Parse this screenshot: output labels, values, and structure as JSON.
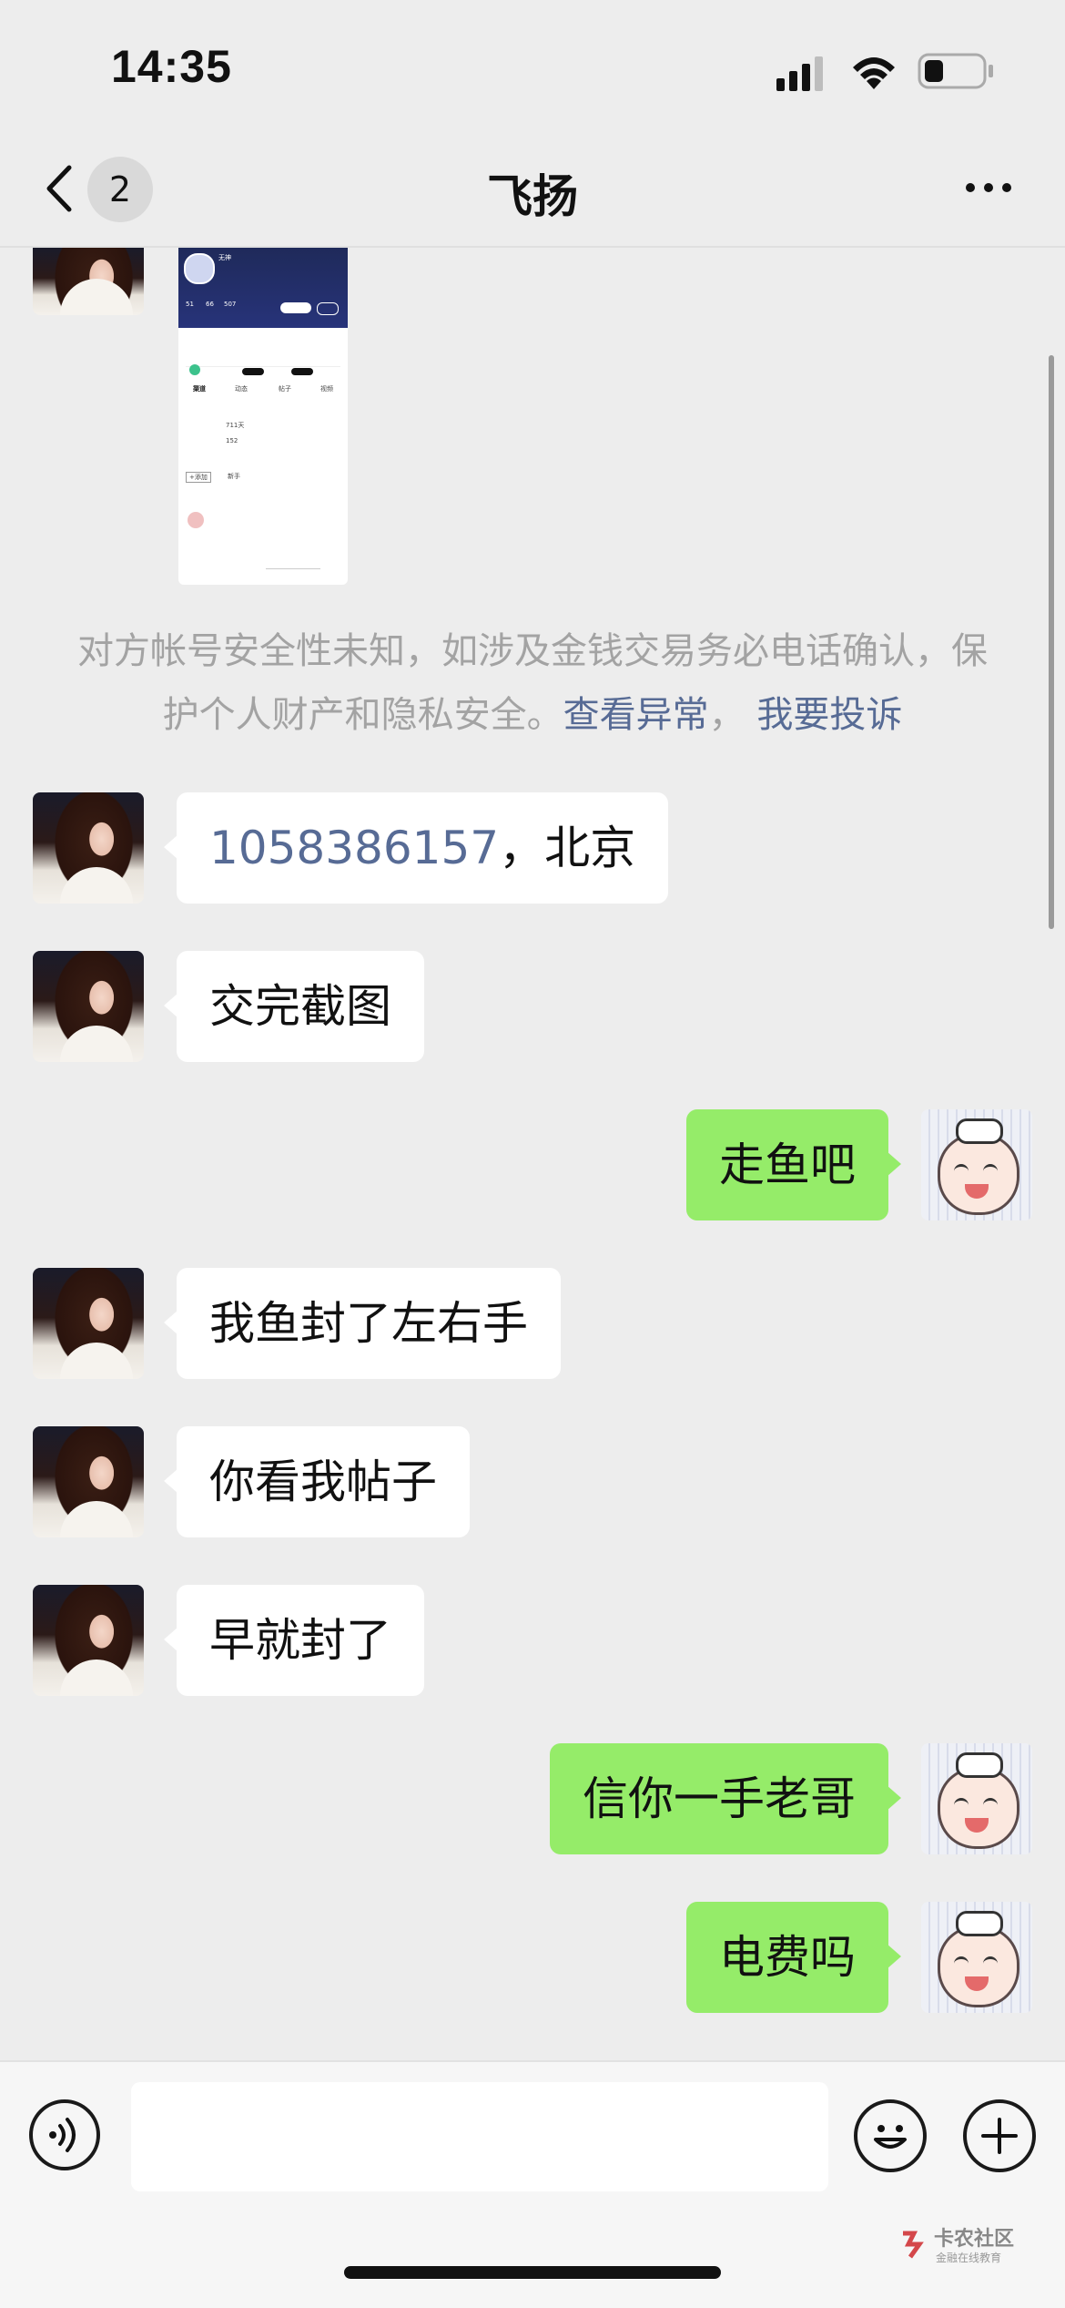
{
  "status_bar": {
    "time": "14:35"
  },
  "nav": {
    "badge": "2",
    "title": "飞扬"
  },
  "shared_image": {
    "username": "无神",
    "stats": [
      "51",
      "66",
      "507"
    ],
    "tabs": [
      "渠道",
      "动态",
      "帖子",
      "视频"
    ],
    "rows": [
      "711天",
      "152"
    ],
    "tags": [
      "+添加",
      "新手"
    ]
  },
  "warning": {
    "text": "对方帐号安全性未知，如涉及金钱交易务必电话确认，保护个人财产和隐私安全。",
    "link_abnormal": "查看异常",
    "separator": "，",
    "link_report": "我要投诉"
  },
  "messages": [
    {
      "from": "other",
      "number": "1058386157",
      "text": "，北京"
    },
    {
      "from": "other",
      "text": "交完截图"
    },
    {
      "from": "me",
      "text": "走鱼吧"
    },
    {
      "from": "other",
      "text": "我鱼封了左右手"
    },
    {
      "from": "other",
      "text": "你看我帖子"
    },
    {
      "from": "other",
      "text": "早就封了"
    },
    {
      "from": "me",
      "text": "信你一手老哥"
    },
    {
      "from": "me",
      "text": "电费吗"
    }
  ],
  "input": {
    "placeholder": ""
  },
  "watermark": {
    "name": "卡农社区",
    "sub": "金融在线教育"
  },
  "colors": {
    "background": "#ededed",
    "outgoing": "#95ec69",
    "incoming": "#ffffff",
    "link": "#576b95"
  }
}
